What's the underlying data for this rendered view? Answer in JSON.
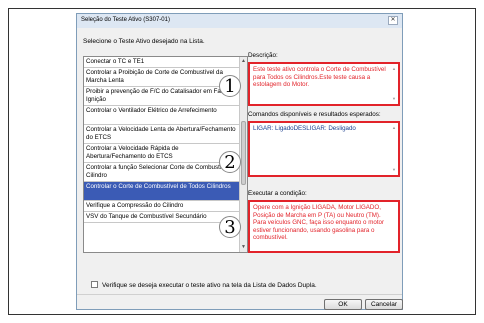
{
  "window": {
    "title": "Seleção do Teste Ativo (S307-01)",
    "close_glyph": "✕"
  },
  "prompt": "Selecione o Teste Ativo desejado na Lista.",
  "list": {
    "items": [
      {
        "label": "Conectar o TC e TE1"
      },
      {
        "label": "Controlar a Proibição de Corte de Combustível da Marcha Lenta"
      },
      {
        "label": "Proibir a prevenção de F/C do Catalisador em Falha da Ignição"
      },
      {
        "label": "Controlar o Ventilador Elétrico de Arrefecimento"
      },
      {
        "label": "Controlar a Velocidade Lenta de Abertura/Fechamento do ETCS"
      },
      {
        "label": "Controlar a Velocidade Rápida de Abertura/Fechamento do ETCS"
      },
      {
        "label": "Controlar a função Selecionar Corte de Combustível do Cilindro"
      },
      {
        "label": "Controlar o Corte de Combustível de Todos Cilindros"
      },
      {
        "label": "Verifique a Compressão do Cilindro"
      },
      {
        "label": "VSV do Tanque de Combustível Secundário"
      }
    ],
    "selected_index": 7,
    "scroll_up_glyph": "▲",
    "scroll_down_glyph": "▼"
  },
  "description": {
    "label": "Descrição:",
    "text": "Este teste ativo controla o Corte de Combustível para Todos os Cilindros.Este teste causa a estolagem do Motor."
  },
  "commands": {
    "label": "Comandos disponíveis e resultados esperados:",
    "text": "LIGAR: LigadoDESLIGAR: Desligado"
  },
  "condition": {
    "label": "Executar a condição:",
    "text": "Opere com a Ignição LIGADA, Motor LIGADO, Posição de Marcha em P (TA) ou Neutro (TM). Para veículos GNC, faça isso enquanto o motor estiver funcionando, usando gasolina para o combustível."
  },
  "callouts": [
    "1",
    "2",
    "3"
  ],
  "checkbox": {
    "label": "Verifique se deseja executar o teste ativo na tela da Lista de Dados Dupla.",
    "checked": false
  },
  "buttons": {
    "ok": "OK",
    "cancel": "Cancelar"
  },
  "colors": {
    "highlight_border": "#e2232a",
    "selected_row": "#3b5bb5"
  }
}
